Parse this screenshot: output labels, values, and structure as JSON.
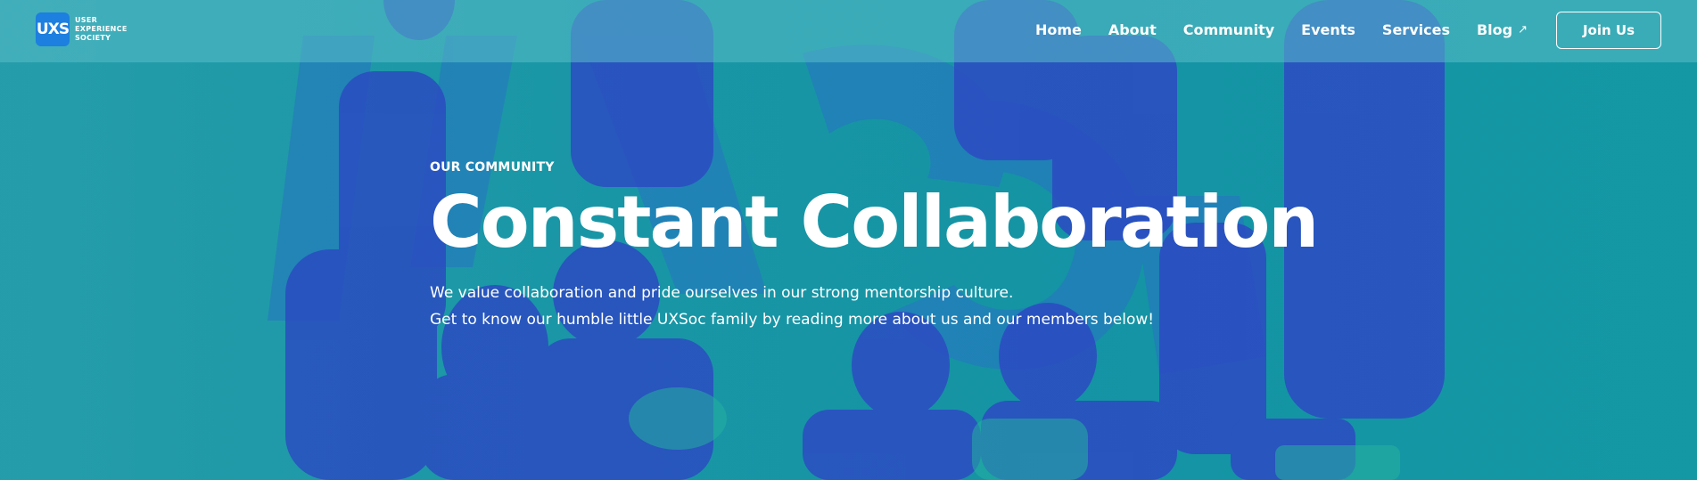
{
  "brand": {
    "logo_mark": "UXS",
    "logo_line1": "USER",
    "logo_line2": "EXPERIENCE",
    "logo_line3": "SOCIETY"
  },
  "nav": {
    "items": [
      {
        "label": "Home"
      },
      {
        "label": "About"
      },
      {
        "label": "Community"
      },
      {
        "label": "Events"
      },
      {
        "label": "Services"
      },
      {
        "label": "Blog"
      }
    ],
    "blog_external_icon": "↗",
    "join_label": "Join Us"
  },
  "hero": {
    "eyebrow": "OUR COMMUNITY",
    "title": "Constant Collaboration",
    "description_line1": "We value collaboration and pride ourselves in our strong mentorship culture.",
    "description_line2": "Get to know our humble little UXSoc family by reading more about us and our members below!"
  },
  "colors": {
    "teal": "#1b9aa8",
    "blue_tone": "#2c4fd0",
    "logo_blue": "#1d7fe0",
    "white": "#ffffff"
  }
}
